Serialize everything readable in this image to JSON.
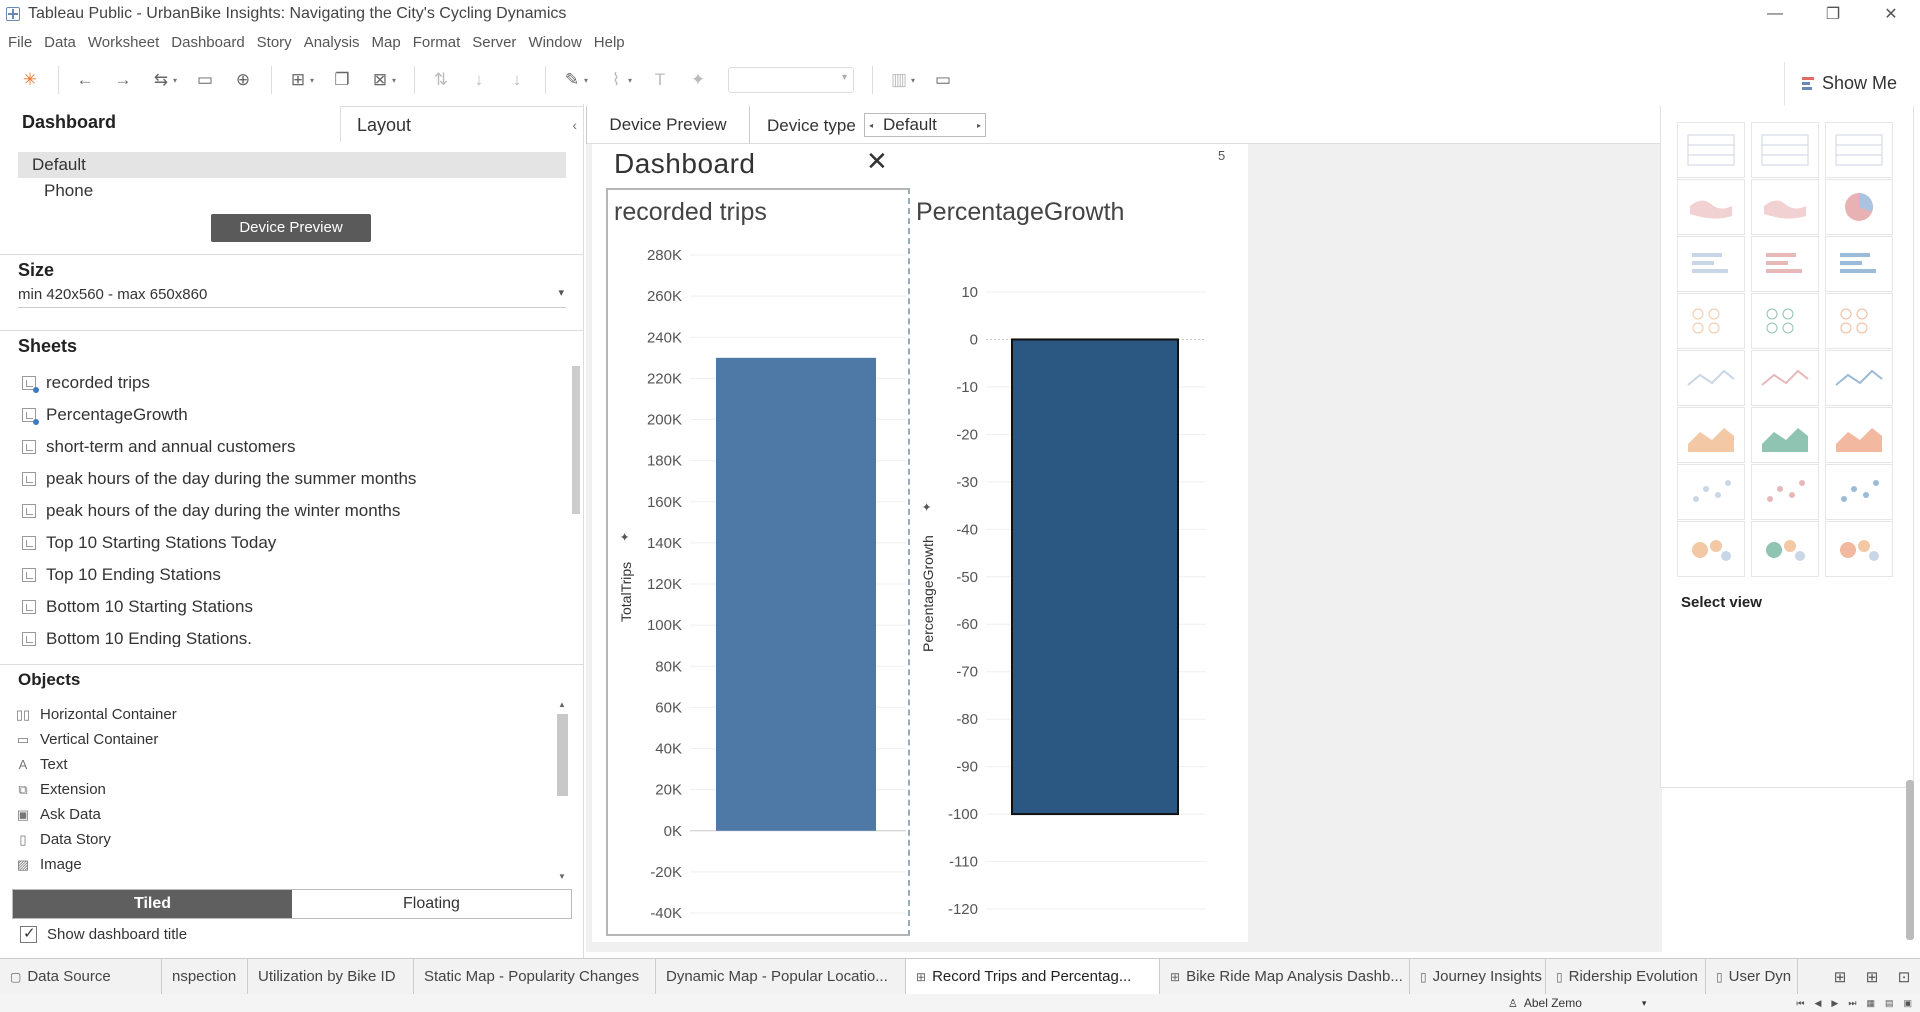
{
  "window": {
    "title": "Tableau Public - UrbanBike Insights: Navigating the City's Cycling Dynamics",
    "minimize": "—",
    "restore": "❐",
    "close": "✕"
  },
  "menu": [
    "File",
    "Data",
    "Worksheet",
    "Dashboard",
    "Story",
    "Analysis",
    "Map",
    "Format",
    "Server",
    "Window",
    "Help"
  ],
  "toolbar": {
    "show_me_label": "Show Me"
  },
  "left_panel": {
    "dashboard_tab": "Dashboard",
    "layout_tab": "Layout",
    "devices": [
      "Default",
      "Phone"
    ],
    "device_preview_button": "Device Preview",
    "size_title": "Size",
    "size_value": "min 420x560 - max 650x860",
    "sheets_title": "Sheets",
    "sheets": [
      "recorded trips",
      "PercentageGrowth",
      "short-term and annual customers",
      "peak hours of the day during the summer months",
      "peak hours of the day during the winter months",
      "Top 10 Starting Stations Today",
      "Top 10 Ending Stations",
      "Bottom 10 Starting Stations",
      "Bottom 10 Ending Stations."
    ],
    "objects_title": "Objects",
    "objects": [
      {
        "label": "Horizontal Container",
        "icon": "horizontal-container-icon",
        "glyph": "▯▯"
      },
      {
        "label": "Vertical Container",
        "icon": "vertical-container-icon",
        "glyph": "▭"
      },
      {
        "label": "Text",
        "icon": "text-icon",
        "glyph": "A"
      },
      {
        "label": "Extension",
        "icon": "extension-icon",
        "glyph": "⧉"
      },
      {
        "label": "Ask Data",
        "icon": "ask-data-icon",
        "glyph": "▣"
      },
      {
        "label": "Data Story",
        "icon": "data-story-icon",
        "glyph": "▯"
      },
      {
        "label": "Image",
        "icon": "image-icon",
        "glyph": "▨"
      }
    ],
    "tiled_label": "Tiled",
    "floating_label": "Floating",
    "show_title_label": "Show dashboard title"
  },
  "device_bar": {
    "preview_tab": "Device Preview",
    "type_label": "Device type",
    "type_value": "Default"
  },
  "dashboard": {
    "title": "Dashboard",
    "close_glyph": "✕",
    "number": "5"
  },
  "chart_data": [
    {
      "type": "bar",
      "title": "recorded trips",
      "ylabel": "TotalTrips",
      "xlabel": "",
      "categories": [
        ""
      ],
      "values": [
        230000
      ],
      "ylim": [
        -40000,
        280000
      ],
      "yticks": [
        "-40K",
        "-20K",
        "0K",
        "20K",
        "40K",
        "60K",
        "80K",
        "100K",
        "120K",
        "140K",
        "160K",
        "180K",
        "200K",
        "220K",
        "240K",
        "260K",
        "280K"
      ],
      "ytick_values": [
        -40000,
        -20000,
        0,
        20000,
        40000,
        60000,
        80000,
        100000,
        120000,
        140000,
        160000,
        180000,
        200000,
        220000,
        240000,
        260000,
        280000
      ],
      "color": "#4e79a7",
      "grid": true
    },
    {
      "type": "bar",
      "title": "PercentageGrowth",
      "ylabel": "PercentageGrowth",
      "xlabel": "",
      "categories": [
        ""
      ],
      "values": [
        -100
      ],
      "ylim": [
        -120,
        10
      ],
      "yticks": [
        "-120",
        "-110",
        "-100",
        "-90",
        "-80",
        "-70",
        "-60",
        "-50",
        "-40",
        "-30",
        "-20",
        "-10",
        "0",
        "10"
      ],
      "ytick_values": [
        -120,
        -110,
        -100,
        -90,
        -80,
        -70,
        -60,
        -50,
        -40,
        -30,
        -20,
        -10,
        0,
        10
      ],
      "color": "#2b5783",
      "grid": true
    }
  ],
  "show_me": {
    "select_label": "Select view",
    "chart_types": [
      "text-table-icon",
      "heat-map-icon",
      "highlight-table-icon",
      "symbol-map-icon",
      "filled-map-icon",
      "pie-chart-icon",
      "horizontal-bars-icon",
      "stacked-bars-icon",
      "side-by-side-bars-icon",
      "treemap-icon",
      "circle-view-icon",
      "side-by-side-circles-icon",
      "continuous-lines-icon",
      "discrete-lines-icon",
      "dual-lines-icon",
      "area-continuous-icon",
      "area-discrete-icon",
      "dual-combination-icon",
      "scatter-plot-icon",
      "histogram-icon",
      "box-whisker-icon",
      "gantt-chart-icon",
      "bullet-graph-icon",
      "packed-bubbles-icon"
    ]
  },
  "bottom_tabs": [
    {
      "label": "Data Source",
      "icon": "▢",
      "active": false
    },
    {
      "label": "nspection",
      "icon": "",
      "active": false
    },
    {
      "label": "Utilization by Bike ID",
      "icon": "",
      "active": false
    },
    {
      "label": "Static Map - Popularity Changes",
      "icon": "",
      "active": false
    },
    {
      "label": "Dynamic Map - Popular Locatio...",
      "icon": "",
      "active": false
    },
    {
      "label": "Record Trips and Percentag...",
      "icon": "⊞",
      "active": true
    },
    {
      "label": "Bike Ride Map Analysis Dashb...",
      "icon": "⊞",
      "active": false
    },
    {
      "label": "Journey Insights",
      "icon": "▯",
      "active": false
    },
    {
      "label": "Ridership Evolution",
      "icon": "▯",
      "active": false
    },
    {
      "label": "User Dyn",
      "icon": "▯",
      "active": false
    }
  ],
  "status": {
    "user": "Abel Zemo"
  }
}
